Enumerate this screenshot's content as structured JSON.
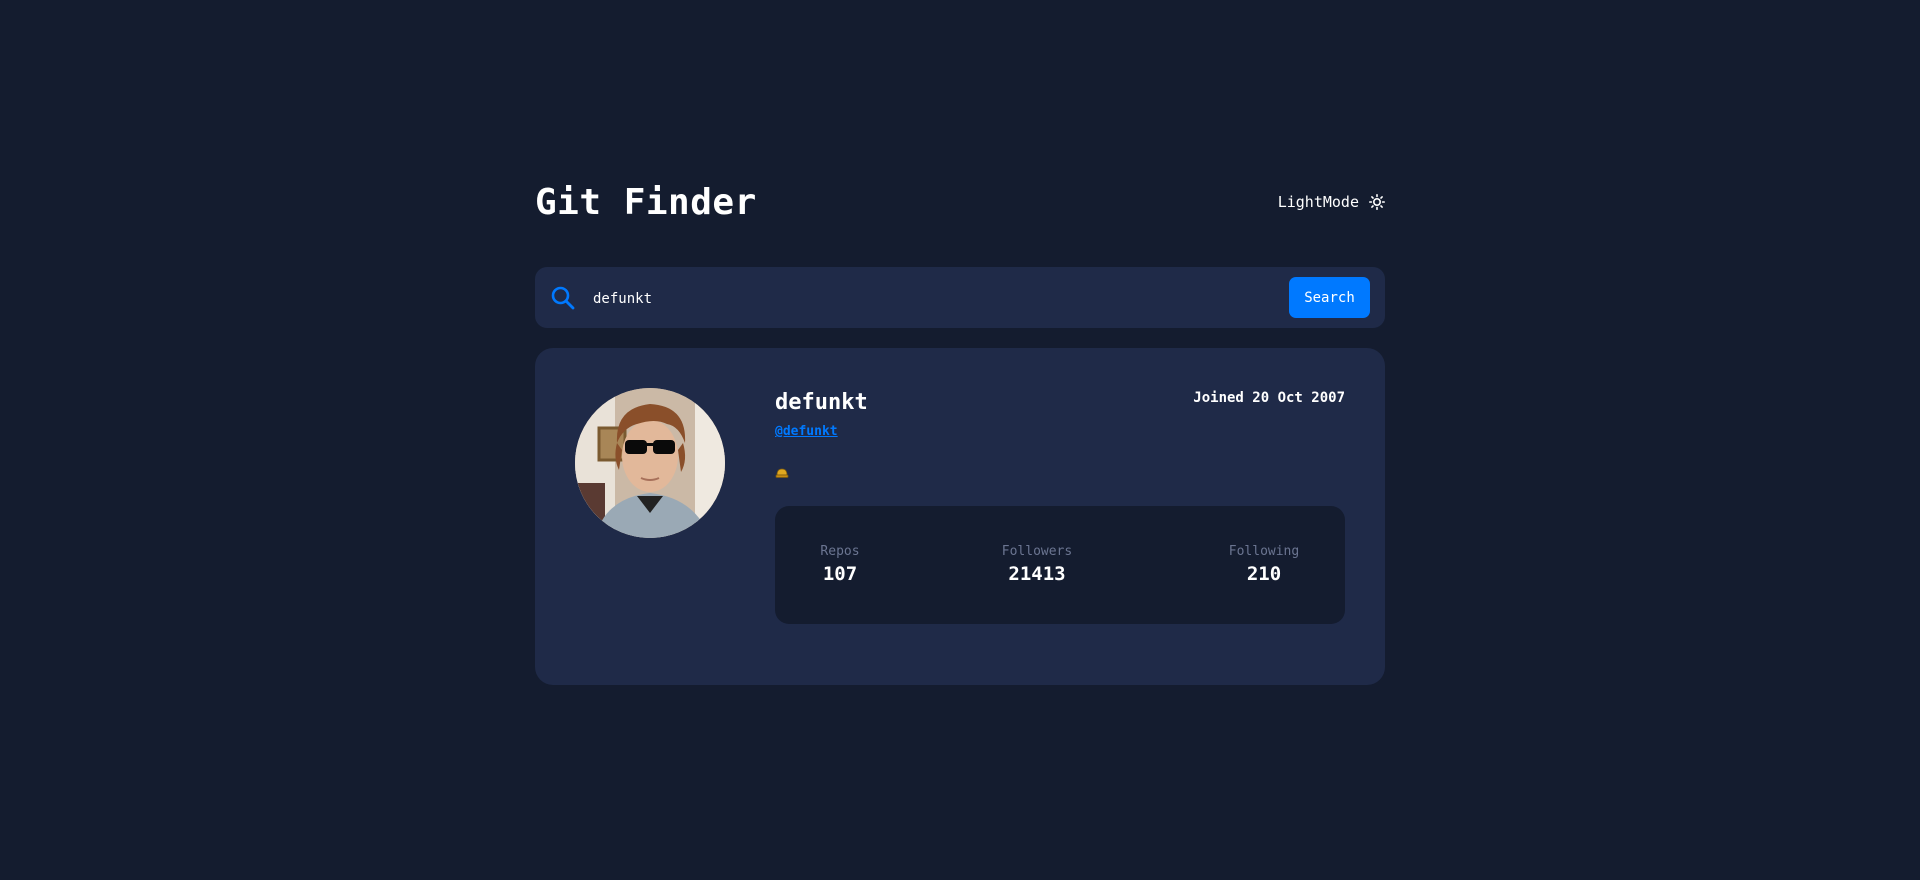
{
  "header": {
    "title": "Git Finder",
    "mode_label": "LightMode",
    "mode_icon": "sun-icon"
  },
  "search": {
    "value": "defunkt",
    "placeholder": "",
    "button_label": "Search",
    "icon": "search-icon"
  },
  "profile": {
    "name": "defunkt",
    "login": "@defunkt",
    "joined": "Joined 20 Oct 2007",
    "bio_icon": "hat-emoji-icon",
    "stats": {
      "repos_label": "Repos",
      "repos_value": "107",
      "followers_label": "Followers",
      "followers_value": "21413",
      "following_label": "Following",
      "following_value": "210"
    }
  },
  "colors": {
    "background": "#141c2f",
    "card": "#1f2a48",
    "accent": "#0079ff",
    "muted": "#6b7591"
  }
}
